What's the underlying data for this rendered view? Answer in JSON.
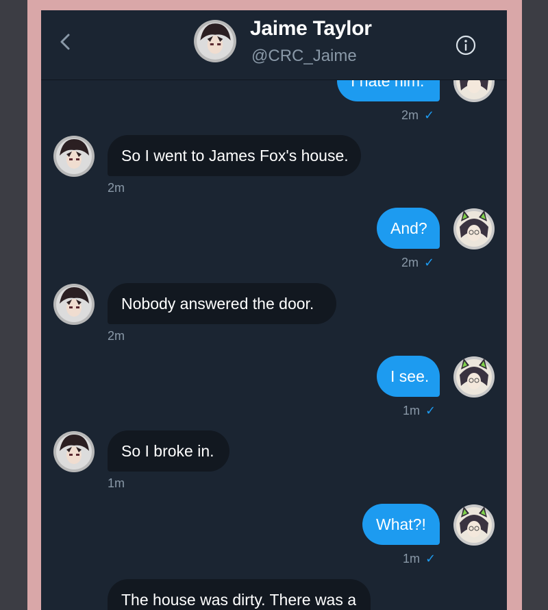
{
  "header": {
    "name": "Jaime Taylor",
    "handle": "@CRC_Jaime",
    "back_icon": "chevron-left-icon",
    "info_icon": "info-icon"
  },
  "colors": {
    "frame": "#d9a7a8",
    "background": "#1b2532",
    "incoming_bubble": "#121820",
    "outgoing_bubble": "#1d9bf0",
    "meta_text": "#8a99a8",
    "read_check": "#1d9bf0"
  },
  "messages": [
    {
      "direction": "out",
      "text": "I hate him.",
      "time": "2m",
      "read_icon": "check-icon"
    },
    {
      "direction": "in",
      "text": "So I went to James Fox's house.",
      "time": "2m"
    },
    {
      "direction": "out",
      "text": "And?",
      "time": "2m",
      "read_icon": "check-icon"
    },
    {
      "direction": "in",
      "text": "Nobody answered the door.",
      "time": "2m"
    },
    {
      "direction": "out",
      "text": "I see.",
      "time": "1m",
      "read_icon": "check-icon"
    },
    {
      "direction": "in",
      "text": "So I broke in.",
      "time": "1m"
    },
    {
      "direction": "out",
      "text": "What?!",
      "time": "1m",
      "read_icon": "check-icon"
    },
    {
      "direction": "in",
      "text": "The house was dirty. There was a",
      "time": ""
    }
  ]
}
